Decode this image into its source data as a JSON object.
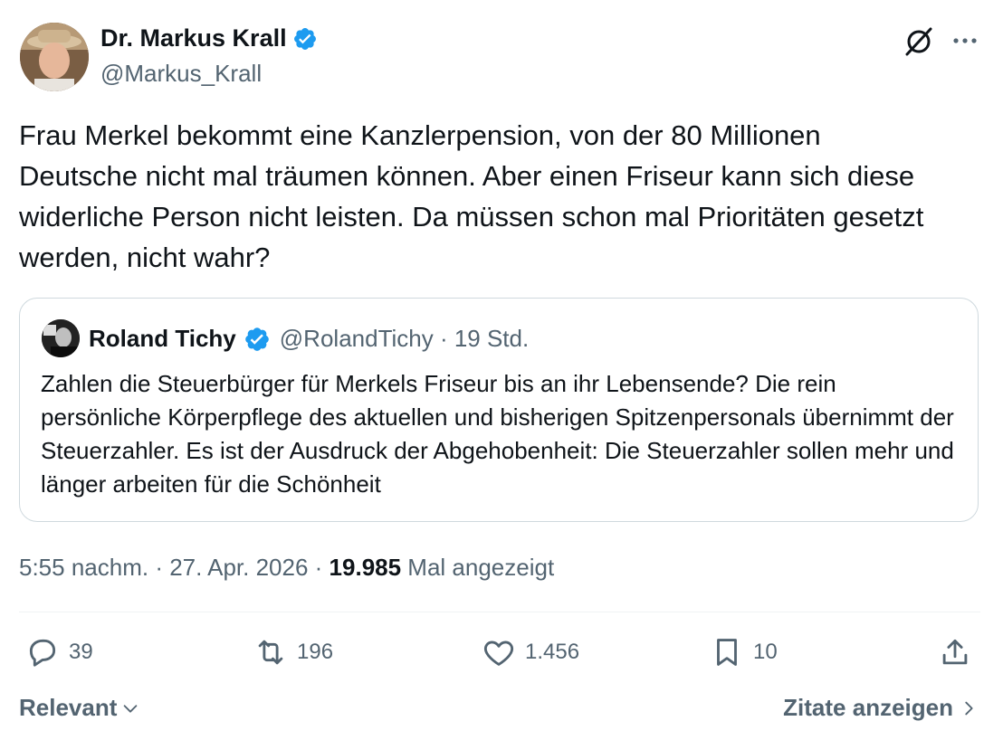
{
  "author": {
    "name": "Dr. Markus Krall",
    "handle": "@Markus_Krall"
  },
  "tweet": {
    "text": "Frau Merkel bekommt eine Kanzlerpension, von der 80 Millionen\nDeutsche nicht mal träumen können. Aber einen Friseur kann sich diese\nwiderliche Person nicht leisten. Da müssen schon mal Prioritäten gesetzt\nwerden, nicht wahr?"
  },
  "quote": {
    "name": "Roland Tichy",
    "handle_time": "@RolandTichy · 19 Std.",
    "text": "Zahlen die Steuerbürger für Merkels Friseur bis an ihr Lebensende? Die rein persönliche Körperpflege des aktuellen und bisherigen Spitzenpersonals übernimmt der Steuerzahler. Es ist der Ausdruck der Abgehobenheit: Die Steuerzahler sollen mehr und länger arbeiten für die Schönheit"
  },
  "meta": {
    "time": "5:55 nachm. · 27. Apr. 2026 · ",
    "views": "19.985",
    "views_label": " Mal angezeigt"
  },
  "actions": {
    "replies": "39",
    "reposts": "196",
    "likes": "1.456",
    "bookmarks": "10"
  },
  "footer": {
    "sort_label": "Relevant",
    "quotes_link": "Zitate anzeigen"
  },
  "colors": {
    "verified": "#1d9bf0",
    "text_primary": "#0f1419",
    "text_secondary": "#536471",
    "border": "#cfd9de"
  },
  "icons": [
    "verified-badge-icon",
    "grok-icon",
    "more-icon",
    "reply-icon",
    "repost-icon",
    "like-icon",
    "bookmark-icon",
    "share-icon",
    "chevron-down-icon",
    "chevron-right-icon"
  ]
}
